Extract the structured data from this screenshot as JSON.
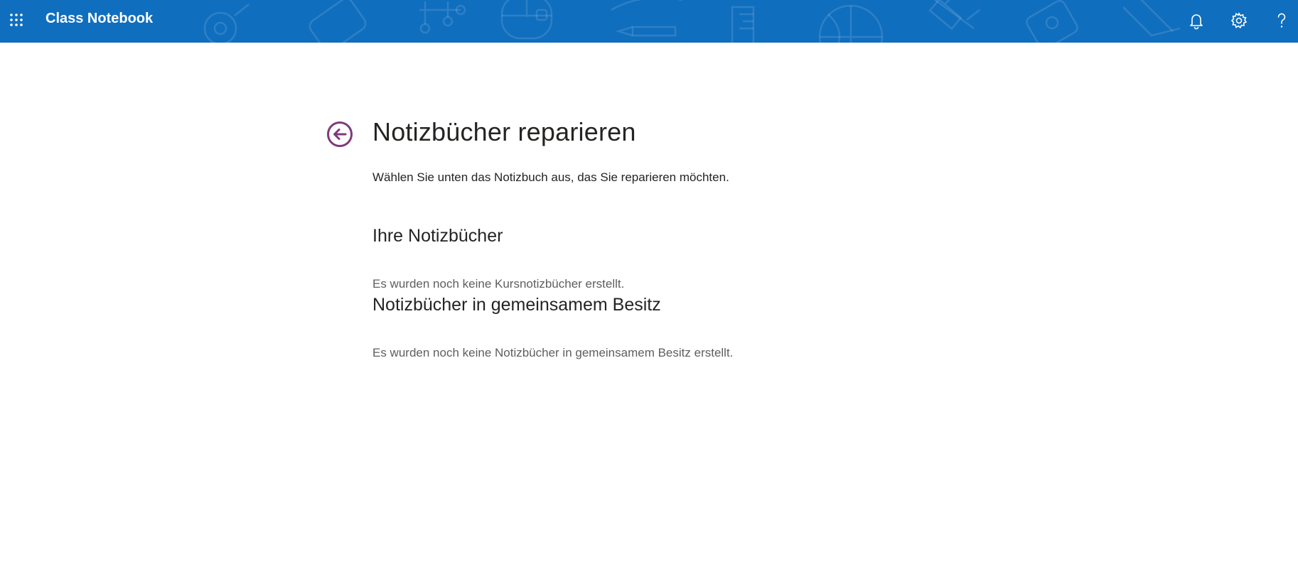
{
  "app": {
    "title": "Class Notebook",
    "brand_color": "#106ebe",
    "icons": {
      "launcher": "app-launcher-waffle-icon",
      "notifications": "bell-icon",
      "settings": "gear-icon",
      "help": "question-mark-icon",
      "back": "back-arrow-circle-icon"
    }
  },
  "page": {
    "title": "Notizbücher reparieren",
    "subtitle": "Wählen Sie unten das Notizbuch aus, das Sie reparieren möchten.",
    "accent_color": "#80397b"
  },
  "sections": {
    "own": {
      "heading": "Ihre Notizbücher",
      "empty_message": "Es wurden noch keine Kursnotizbücher erstellt."
    },
    "shared": {
      "heading": "Notizbücher in gemeinsamem Besitz",
      "empty_message": "Es wurden noch keine Notizbücher in gemeinsamem Besitz erstellt."
    }
  }
}
